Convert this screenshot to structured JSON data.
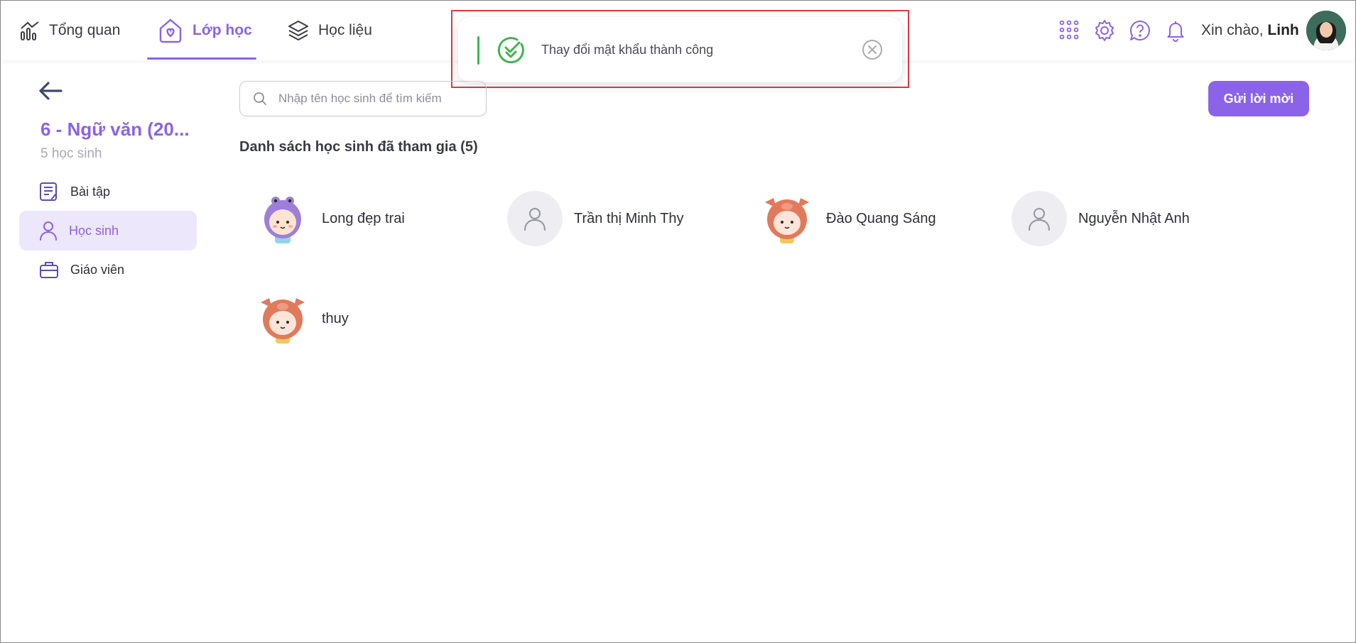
{
  "header": {
    "nav": [
      {
        "label": "Tổng quan",
        "icon": "chart-icon"
      },
      {
        "label": "Lớp học",
        "icon": "class-home-icon",
        "active": true
      },
      {
        "label": "Học liệu",
        "icon": "layers-icon"
      }
    ],
    "greeting_prefix": "Xin chào,",
    "user_name": "Linh"
  },
  "toast": {
    "message": "Thay đổi mật khẩu thành công",
    "accent_color": "#3cb44f"
  },
  "sidebar": {
    "class_title": "6 - Ngữ văn (20...",
    "class_subtitle": "5 học sinh",
    "items": [
      {
        "label": "Bài tập",
        "icon": "assignment-icon"
      },
      {
        "label": "Học sinh",
        "icon": "student-icon",
        "active": true
      },
      {
        "label": "Giáo viên",
        "icon": "teacher-briefcase-icon"
      }
    ]
  },
  "main": {
    "search_placeholder": "Nhập tên học sinh để tìm kiếm",
    "invite_label": "Gửi lời mời",
    "list_title": "Danh sách học sinh đã tham gia (5)",
    "students": [
      {
        "name": "Long đẹp trai",
        "avatar": "frog-girl"
      },
      {
        "name": "Trần thị Minh Thy",
        "avatar": "default"
      },
      {
        "name": "Đào Quang Sáng",
        "avatar": "pig-boy"
      },
      {
        "name": "Nguyễn Nhật Anh",
        "avatar": "default"
      },
      {
        "name": "thuy",
        "avatar": "pig-boy"
      }
    ]
  },
  "colors": {
    "brand": "#8a63e8",
    "text": "#2f2f3a",
    "muted": "#a9a9b3"
  }
}
